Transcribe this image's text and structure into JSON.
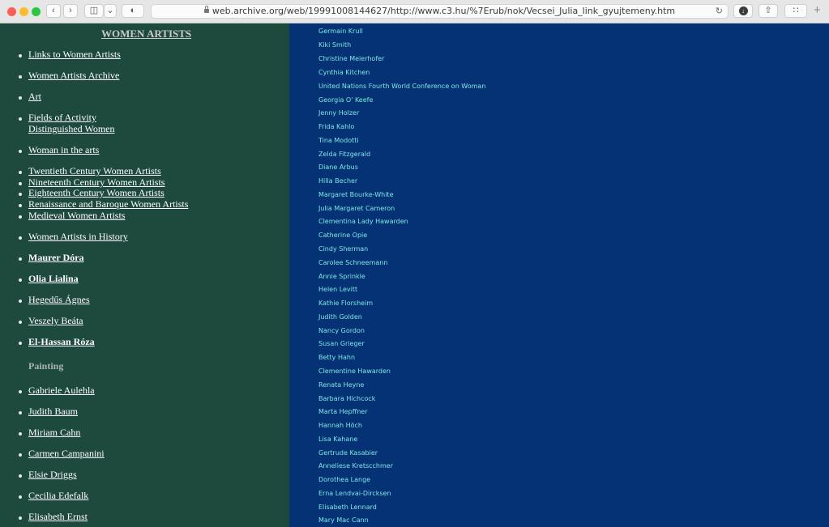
{
  "browser": {
    "url": "web.archive.org/web/19991008144627/http://www.c3.hu/%7Erub/nok/Vecsei_Julia_link_gyujtemeny.htm"
  },
  "colors": {
    "left_bg": "#1e4a3d",
    "right_bg": "#053274",
    "name_text": "#7ee6e6"
  },
  "left": {
    "heading": "WOMEN ARTISTS",
    "items": [
      "Links to Women Artists",
      "Women Artists Archive",
      "Art",
      "Fields of Activity",
      "Distinguished Women",
      "Woman in the arts",
      "Twentieth Century Women Artists",
      "Nineteenth Century Women Artists",
      "Eighteenth Century Women Artists",
      "Renaissance and Baroque Women Artists",
      "Medieval Women Artists",
      "Women Artists in History",
      "Maurer Dóra",
      "Olia Lialina",
      "Hegedűs Ágnes",
      "Veszely Beáta",
      "El-Hassan Róza"
    ],
    "painting_label": "Painting",
    "painting_items": [
      "Gabriele Aulehla",
      "Judith Baum",
      "Miriam Cahn",
      "Carmen Campanini",
      "Elsie Driggs",
      "Cecilia Edefalk",
      "Elisabeth Ernst"
    ]
  },
  "right": {
    "names": [
      "Germain Krull",
      "Kiki Smith",
      "Christine Meierhofer",
      "Cynthia Kitchen",
      "United Nations Fourth World Conference on Woman",
      "Georgia O' Keefe",
      "Jenny Holzer",
      "Frida Kahlo",
      "Tina Modotti",
      "Zelda Fitzgerald",
      "Diane Arbus",
      "Hilla Becher",
      "Margaret Bourke-White",
      "Julia Margaret Cameron",
      "Clementina Lady Hawarden",
      "Catherine Opie",
      "Cindy Sherman",
      "Carolee Schneemann",
      "Annie Sprinkle",
      "Helen Levitt",
      "Kathie Florsheim",
      "Judith Golden",
      "Nancy Gordon",
      "Susan Grieger",
      "Betty Hahn",
      "Clementine Hawarden",
      "Renata Heyne",
      "Barbara Hichcock",
      "Marta Hepffner",
      "Hannah Höch",
      "Lisa Kahane",
      "Gertrude Kasabier",
      "Anneliese Kretscchmer",
      "Dorothea Lange",
      "Erna Lendvai-Dircksen",
      "Elisabeth Lennard",
      "Mary Mac Cann"
    ]
  }
}
